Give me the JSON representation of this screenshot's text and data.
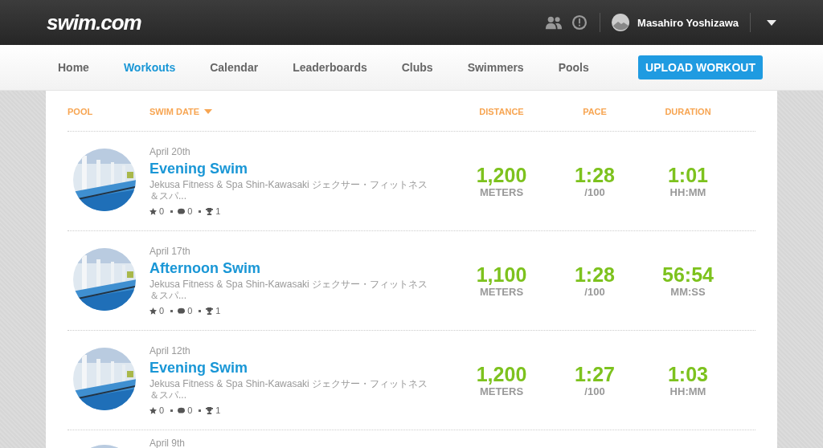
{
  "header": {
    "logo": "swim.com",
    "user_name": "Masahiro Yoshizawa"
  },
  "nav": {
    "items": [
      {
        "label": "Home",
        "selected": false
      },
      {
        "label": "Workouts",
        "selected": true
      },
      {
        "label": "Calendar",
        "selected": false
      },
      {
        "label": "Leaderboards",
        "selected": false
      },
      {
        "label": "Clubs",
        "selected": false
      },
      {
        "label": "Swimmers",
        "selected": false
      },
      {
        "label": "Pools",
        "selected": false
      }
    ],
    "upload_button": "UPLOAD WORKOUT"
  },
  "table": {
    "columns": [
      "POOL",
      "SWIM DATE",
      "DISTANCE",
      "PACE",
      "DURATION"
    ],
    "rows": [
      {
        "date": "April 20th",
        "title": "Evening Swim",
        "pool": "Jekusa Fitness & Spa Shin-Kawasaki ジェクサー・フィットネス＆スパ...",
        "likes": "0",
        "comments": "0",
        "trophies": "1",
        "distance": "1,200",
        "distance_unit": "METERS",
        "pace": "1:28",
        "pace_unit": "/100",
        "duration": "1:01",
        "duration_unit": "HH:MM"
      },
      {
        "date": "April 17th",
        "title": "Afternoon Swim",
        "pool": "Jekusa Fitness & Spa Shin-Kawasaki ジェクサー・フィットネス＆スパ...",
        "likes": "0",
        "comments": "0",
        "trophies": "1",
        "distance": "1,100",
        "distance_unit": "METERS",
        "pace": "1:28",
        "pace_unit": "/100",
        "duration": "56:54",
        "duration_unit": "MM:SS"
      },
      {
        "date": "April 12th",
        "title": "Evening Swim",
        "pool": "Jekusa Fitness & Spa Shin-Kawasaki ジェクサー・フィットネス＆スパ...",
        "likes": "0",
        "comments": "0",
        "trophies": "1",
        "distance": "1,200",
        "distance_unit": "METERS",
        "pace": "1:27",
        "pace_unit": "/100",
        "duration": "1:03",
        "duration_unit": "HH:MM"
      },
      {
        "date": "April 9th"
      }
    ]
  }
}
